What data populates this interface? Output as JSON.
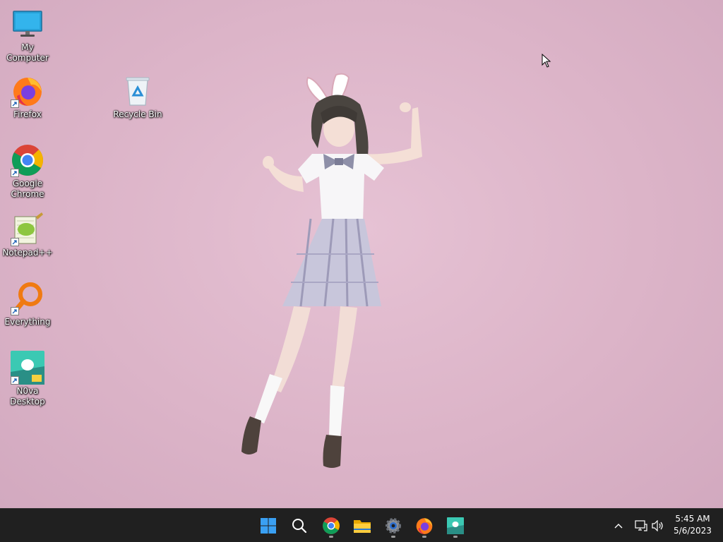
{
  "desktop": {
    "icons": [
      {
        "label": "My Computer",
        "icon": "monitor-icon"
      },
      {
        "label": "Firefox",
        "icon": "firefox-icon"
      },
      {
        "label": "Recycle Bin",
        "icon": "recycle-bin-icon"
      },
      {
        "label": "Google Chrome",
        "icon": "chrome-icon"
      },
      {
        "label": "Notepad++",
        "icon": "notepad-plus-plus-icon"
      },
      {
        "label": "Everything",
        "icon": "everything-search-icon"
      },
      {
        "label": "N0va Desktop",
        "icon": "n0va-desktop-icon"
      }
    ],
    "wallpaper": "anime-girl-bunny-ears-pink-background",
    "background_color": "#dcb4c8"
  },
  "taskbar": {
    "apps": [
      {
        "name": "Start",
        "icon": "windows-start-icon"
      },
      {
        "name": "Search",
        "icon": "search-icon"
      },
      {
        "name": "Google Chrome",
        "icon": "chrome-icon"
      },
      {
        "name": "File Explorer",
        "icon": "folder-icon"
      },
      {
        "name": "Settings",
        "icon": "gear-icon"
      },
      {
        "name": "Firefox",
        "icon": "firefox-icon"
      },
      {
        "name": "N0va Desktop",
        "icon": "n0va-desktop-icon"
      }
    ],
    "tray": {
      "overflow_icon": "chevron-up-icon",
      "network_icon": "network-icon",
      "volume_icon": "volume-icon"
    },
    "clock": {
      "time": "5:45 AM",
      "date": "5/6/2023"
    },
    "background_color": "#202020"
  }
}
